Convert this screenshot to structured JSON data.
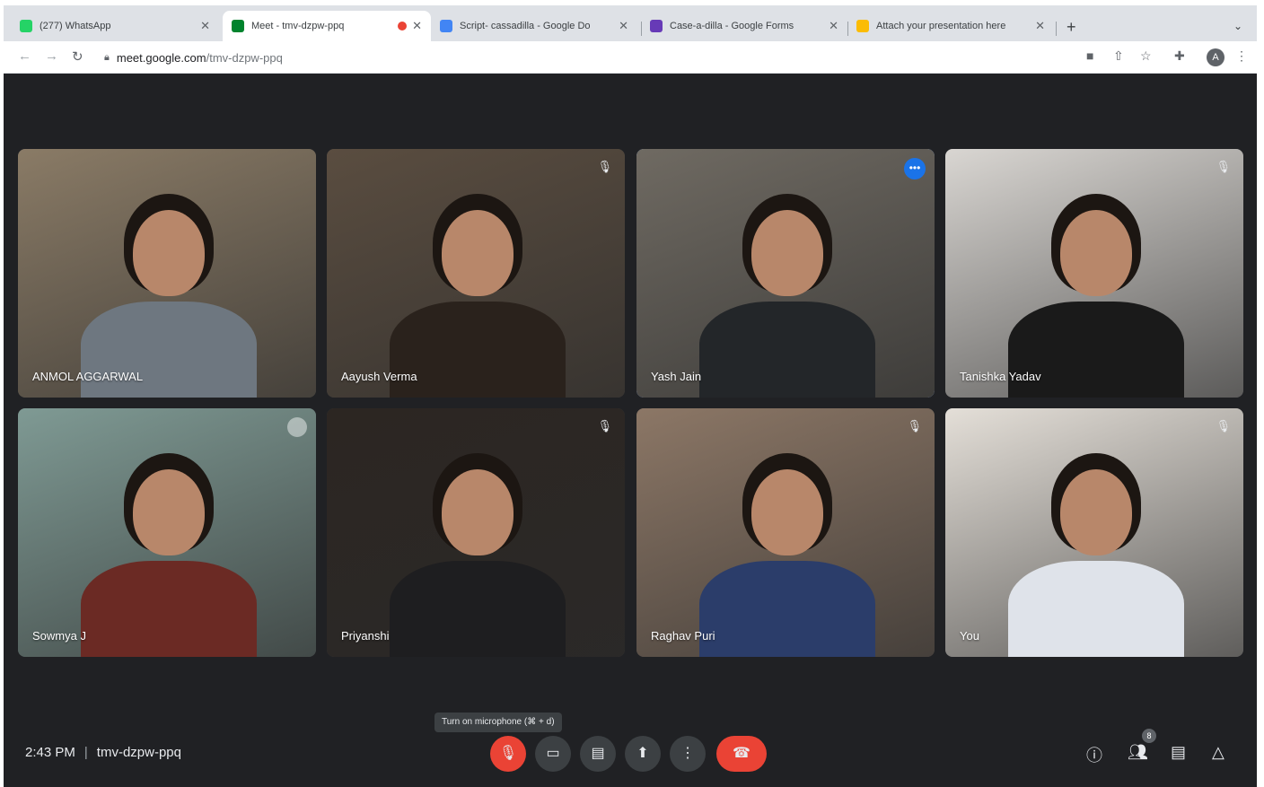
{
  "browser": {
    "tabs": [
      {
        "title": "(277) WhatsApp",
        "favicon_color": "#25d366",
        "active": false
      },
      {
        "title": "Meet - tmv-dzpw-ppq",
        "favicon_color": "#00832d",
        "active": true,
        "recording": true
      },
      {
        "title": "Script- cassadilla - Google Do",
        "favicon_color": "#4285f4",
        "active": false
      },
      {
        "title": "Case-a-dilla - Google Forms",
        "favicon_color": "#673ab7",
        "active": false
      },
      {
        "title": "Attach your presentation here",
        "favicon_color": "#fbbc04",
        "active": false
      }
    ],
    "url_host": "meet.google.com",
    "url_path": "/tmv-dzpw-ppq",
    "profile_initial": "A"
  },
  "meet": {
    "participants": [
      {
        "name": "ANMOL AGGARWAL",
        "bg": "#8a7b66",
        "shirt": "#6e7780",
        "muted": false,
        "active": false
      },
      {
        "name": "Aayush Verma",
        "bg": "#5a4d40",
        "shirt": "#2a221c",
        "muted": true,
        "active": false
      },
      {
        "name": "Yash Jain",
        "bg": "#6f6a62",
        "shirt": "#232629",
        "muted": false,
        "active": true
      },
      {
        "name": "Tanishka Yadav",
        "bg": "#d9d6d2",
        "shirt": "#1a1a1a",
        "muted": true,
        "active": false
      },
      {
        "name": "Sowmya J",
        "bg": "#7f9a94",
        "shirt": "#6b2a24",
        "muted": false,
        "active": false,
        "speaking": true
      },
      {
        "name": "Priyanshi",
        "bg": "#2c2622",
        "shirt": "#1e1e20",
        "muted": true,
        "active": false
      },
      {
        "name": "Raghav Puri",
        "bg": "#8c7766",
        "shirt": "#2b3d6a",
        "muted": true,
        "active": false
      },
      {
        "name": "You",
        "bg": "#e4dfd8",
        "shirt": "#dfe3ea",
        "muted": true,
        "active": false
      }
    ],
    "time": "2:43 PM",
    "meeting_code": "tmv-dzpw-ppq",
    "mic_tooltip": "Turn on microphone (⌘ + d)",
    "people_count": "8"
  }
}
